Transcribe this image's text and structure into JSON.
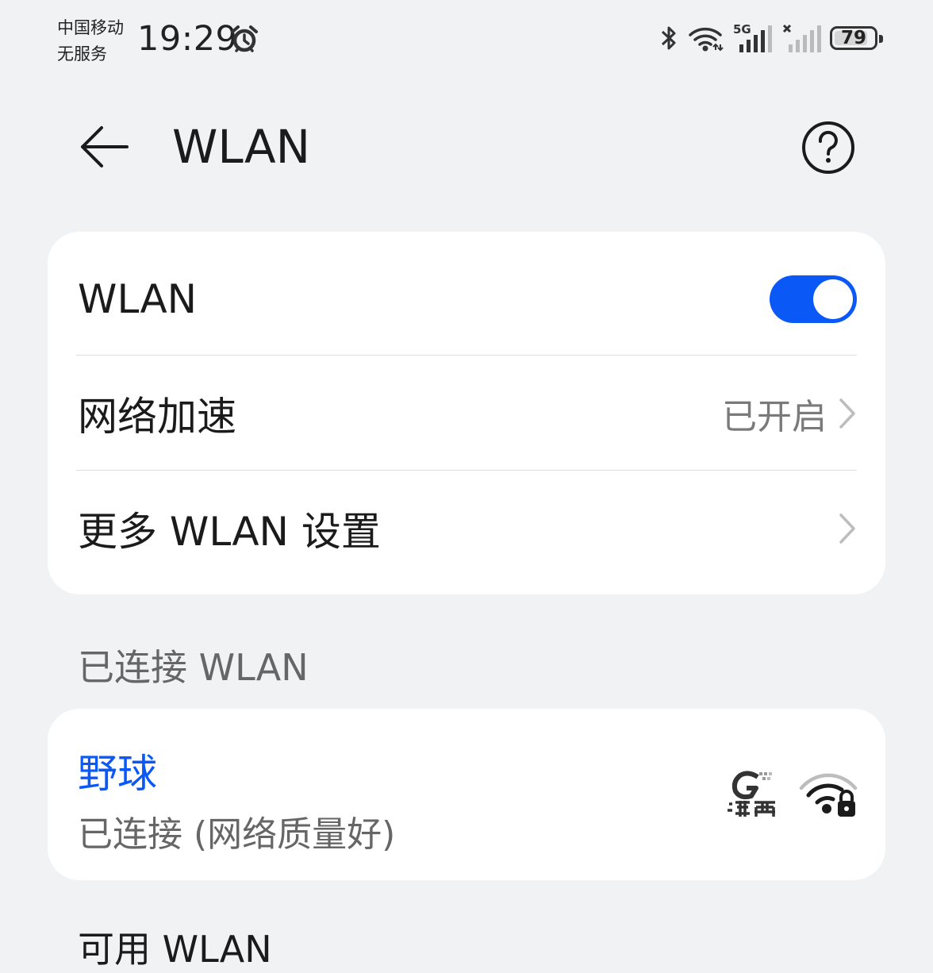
{
  "status_bar": {
    "carrier_line1": "中国移动",
    "carrier_line2": "无服务",
    "time": "19:29",
    "signal_label": "5G",
    "battery_percent": "79",
    "icons": [
      "alarm-icon",
      "bluetooth-icon",
      "wifi-icon",
      "signal-5g-icon",
      "signal-no-service-icon",
      "battery-icon"
    ]
  },
  "header": {
    "title": "WLAN",
    "back_icon": "back-arrow-icon",
    "help_icon": "help-icon"
  },
  "settings_card": {
    "wlan_label": "WLAN",
    "wlan_enabled": true,
    "acceleration_label": "网络加速",
    "acceleration_value": "已开启",
    "more_settings_label": "更多 WLAN 设置"
  },
  "connected_section": {
    "title": "已连接 WLAN",
    "network_name": "野球",
    "network_status": "已连接 (网络质量好)",
    "brand_icon": "lingxiao-logo-icon",
    "secure_wifi_icon": "wifi-lock-icon"
  },
  "next_section": {
    "title": "可用 WLAN"
  },
  "colors": {
    "accent": "#0a59f7",
    "background": "#f1f2f4",
    "card": "#ffffff",
    "secondary_text": "#666666"
  }
}
